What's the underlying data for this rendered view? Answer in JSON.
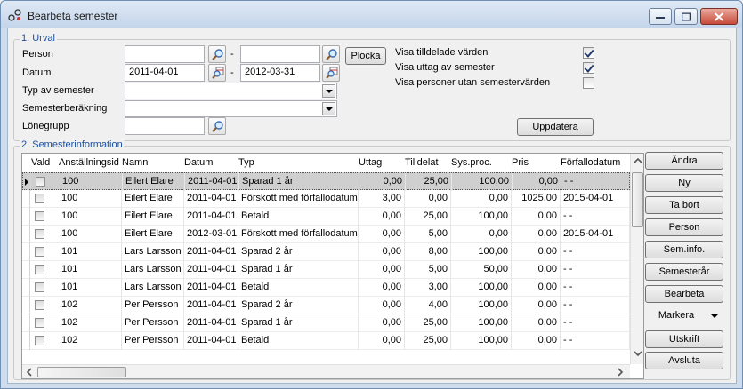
{
  "window": {
    "title": "Bearbeta semester"
  },
  "urval": {
    "legend": "1. Urval",
    "person_label": "Person",
    "person_from": "",
    "person_to": "",
    "range_sep": "-",
    "plocka_label": "Plocka",
    "datum_label": "Datum",
    "datum_from": "2011-04-01",
    "datum_to": "2012-03-31",
    "typ_label": "Typ av semester",
    "typ_value": "",
    "berakning_label": "Semesterberäkning",
    "berakning_value": "",
    "lonegrupp_label": "Lönegrupp",
    "lonegrupp_value": "",
    "visa_tilldelade": "Visa tilldelade värden",
    "visa_tilldelade_checked": true,
    "visa_uttag": "Visa uttag av semester",
    "visa_uttag_checked": true,
    "visa_utan": "Visa personer utan semestervärden",
    "visa_utan_checked": false,
    "uppdatera_label": "Uppdatera"
  },
  "info": {
    "legend": "2. Semesterinformation",
    "columns": [
      "Vald",
      "Anställningsid",
      "Namn",
      "Datum",
      "Typ",
      "Uttag",
      "Tilldelat",
      "Sys.proc.",
      "Pris",
      "Förfallodatum"
    ],
    "rows": [
      {
        "id": "100",
        "namn": "Eilert Elare",
        "datum": "2011-04-01",
        "typ": "Sparad 1 år",
        "uttag": "0,00",
        "tilldelat": "25,00",
        "sysproc": "100,00",
        "pris": "0,00",
        "forfall": "- -"
      },
      {
        "id": "100",
        "namn": "Eilert Elare",
        "datum": "2011-04-01",
        "typ": "Förskott med förfallodatum",
        "uttag": "3,00",
        "tilldelat": "0,00",
        "sysproc": "0,00",
        "pris": "1025,00",
        "forfall": "2015-04-01"
      },
      {
        "id": "100",
        "namn": "Eilert Elare",
        "datum": "2011-04-01",
        "typ": "Betald",
        "uttag": "0,00",
        "tilldelat": "25,00",
        "sysproc": "100,00",
        "pris": "0,00",
        "forfall": "- -"
      },
      {
        "id": "100",
        "namn": "Eilert Elare",
        "datum": "2012-03-01",
        "typ": "Förskott med förfallodatum",
        "uttag": "0,00",
        "tilldelat": "5,00",
        "sysproc": "0,00",
        "pris": "0,00",
        "forfall": "2015-04-01"
      },
      {
        "id": "101",
        "namn": "Lars Larsson",
        "datum": "2011-04-01",
        "typ": "Sparad 2 år",
        "uttag": "0,00",
        "tilldelat": "8,00",
        "sysproc": "100,00",
        "pris": "0,00",
        "forfall": "- -"
      },
      {
        "id": "101",
        "namn": "Lars Larsson",
        "datum": "2011-04-01",
        "typ": "Sparad 1 år",
        "uttag": "0,00",
        "tilldelat": "5,00",
        "sysproc": "50,00",
        "pris": "0,00",
        "forfall": "- -"
      },
      {
        "id": "101",
        "namn": "Lars Larsson",
        "datum": "2011-04-01",
        "typ": "Betald",
        "uttag": "0,00",
        "tilldelat": "3,00",
        "sysproc": "100,00",
        "pris": "0,00",
        "forfall": "- -"
      },
      {
        "id": "102",
        "namn": "Per Persson",
        "datum": "2011-04-01",
        "typ": "Sparad 2 år",
        "uttag": "0,00",
        "tilldelat": "4,00",
        "sysproc": "100,00",
        "pris": "0,00",
        "forfall": "- -"
      },
      {
        "id": "102",
        "namn": "Per Persson",
        "datum": "2011-04-01",
        "typ": "Sparad 1 år",
        "uttag": "0,00",
        "tilldelat": "25,00",
        "sysproc": "100,00",
        "pris": "0,00",
        "forfall": "- -"
      },
      {
        "id": "102",
        "namn": "Per Persson",
        "datum": "2011-04-01",
        "typ": "Betald",
        "uttag": "0,00",
        "tilldelat": "25,00",
        "sysproc": "100,00",
        "pris": "0,00",
        "forfall": "- -"
      }
    ],
    "buttons": [
      "Ändra",
      "Ny",
      "Ta bort",
      "Person",
      "Sem.info.",
      "Semesterår",
      "Bearbeta",
      "Markera",
      "Utskrift",
      "Avsluta"
    ]
  },
  "colors": {
    "legend": "#1e50a0",
    "selected_row": "#cfcfcf"
  },
  "icons": [
    "app-icon",
    "minimize-icon",
    "maximize-icon",
    "close-icon",
    "search-icon",
    "calendar-search-icon",
    "dropdown-arrow-icon"
  ]
}
